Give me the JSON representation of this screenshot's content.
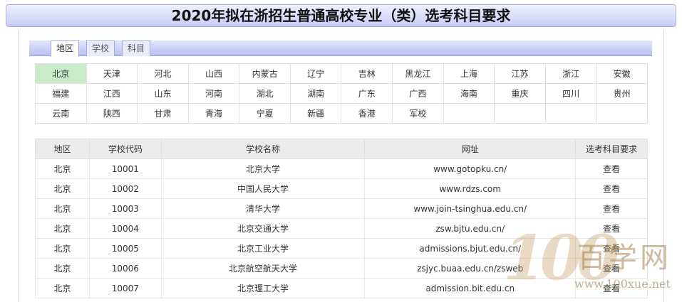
{
  "page_title": "2020年拟在浙招生普通高校专业（类）选考科目要求",
  "tabs": [
    {
      "label": "地区",
      "active": true
    },
    {
      "label": "学校",
      "active": false
    },
    {
      "label": "科目",
      "active": false
    }
  ],
  "regions": [
    [
      "北京",
      "天津",
      "河北",
      "山西",
      "内蒙古",
      "辽宁",
      "吉林",
      "黑龙江",
      "上海",
      "江苏",
      "浙江",
      "安徽"
    ],
    [
      "福建",
      "江西",
      "山东",
      "河南",
      "湖北",
      "湖南",
      "广东",
      "广西",
      "海南",
      "重庆",
      "四川",
      "贵州"
    ],
    [
      "云南",
      "陕西",
      "甘肃",
      "青海",
      "宁夏",
      "新疆",
      "香港",
      "军校",
      "",
      "",
      "",
      ""
    ]
  ],
  "selected_region": "北京",
  "table": {
    "headers": [
      "地区",
      "学校代码",
      "学校名称",
      "网址",
      "选考科目要求"
    ],
    "rows": [
      [
        "北京",
        "10001",
        "北京大学",
        "www.gotopku.cn/",
        "查看"
      ],
      [
        "北京",
        "10002",
        "中国人民大学",
        "www.rdzs.com",
        "查看"
      ],
      [
        "北京",
        "10003",
        "清华大学",
        "www.join-tsinghua.edu.cn/",
        "查看"
      ],
      [
        "北京",
        "10004",
        "北京交通大学",
        "zsw.bjtu.edu.cn/",
        "查看"
      ],
      [
        "北京",
        "10005",
        "北京工业大学",
        "admissions.bjut.edu.cn/",
        "查看"
      ],
      [
        "北京",
        "10006",
        "北京航空航天大学",
        "zsjyc.buaa.edu.cn/zsweb",
        "查看"
      ],
      [
        "北京",
        "10007",
        "北京理工大学",
        "admission.bit.edu.cn",
        "查看"
      ]
    ]
  },
  "watermark": {
    "number": "100",
    "name": "百学网",
    "url": "www.100xue.net"
  },
  "colors": {
    "title_bar": "#c9cdf5",
    "tab_strip": "#b9bff2",
    "selected_region": "#c8ecc8",
    "table_header": "#ececec"
  }
}
